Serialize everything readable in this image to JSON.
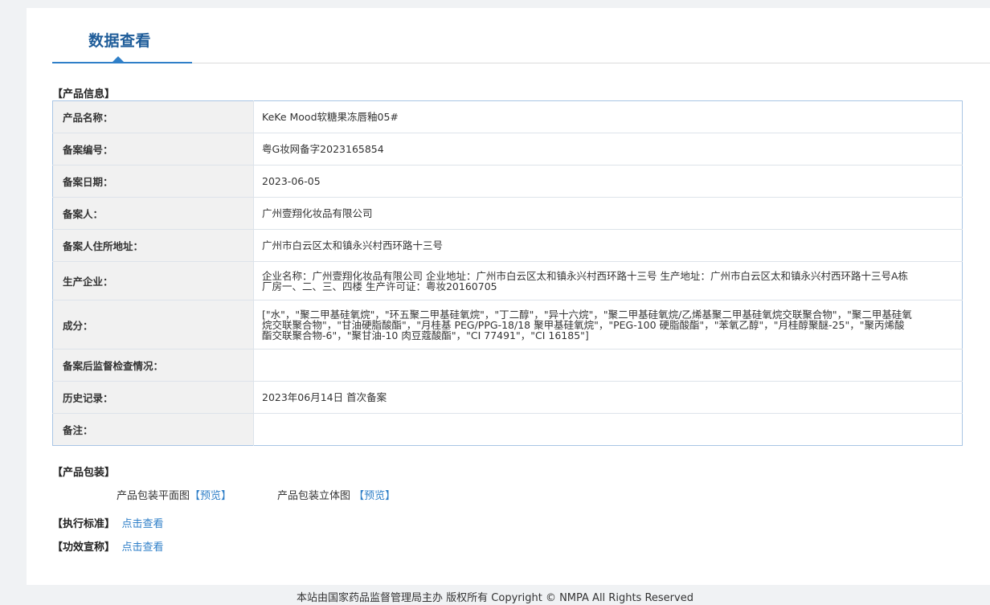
{
  "page": {
    "title": "数据查看"
  },
  "product_info": {
    "section_label": "【产品信息】",
    "rows": [
      {
        "label": "产品名称：",
        "value": "KeKe Mood软糖果冻唇釉05#"
      },
      {
        "label": "备案编号：",
        "value": "粤G妆网备字2023165854"
      },
      {
        "label": "备案日期：",
        "value": "2023-06-05"
      },
      {
        "label": "备案人：",
        "value": "广州壹翔化妆品有限公司"
      },
      {
        "label": "备案人住所地址：",
        "value": "广州市白云区太和镇永兴村西环路十三号"
      },
      {
        "label": "生产企业：",
        "value": "企业名称：广州壹翔化妆品有限公司 企业地址：广州市白云区太和镇永兴村西环路十三号 生产地址：广州市白云区太和镇永兴村西环路十三号A栋厂房一、二、三、四楼 生产许可证：粤妆20160705"
      },
      {
        "label": "成分：",
        "value": "[\"水\"，\"聚二甲基硅氧烷\"，\"环五聚二甲基硅氧烷\"，\"丁二醇\"，\"异十六烷\"，\"聚二甲基硅氧烷/乙烯基聚二甲基硅氧烷交联聚合物\"，\"聚二甲基硅氧烷交联聚合物\"，\"甘油硬脂酸酯\"，\"月桂基 PEG/PPG-18/18 聚甲基硅氧烷\"，\"PEG-100 硬脂酸酯\"，\"苯氧乙醇\"，\"月桂醇聚醚-25\"，\"聚丙烯酸酯交联聚合物-6\"，\"聚甘油-10 肉豆蔻酸酯\"，\"CI 77491\"，\"CI 16185\"]"
      },
      {
        "label": "备案后监督检查情况：",
        "value": ""
      },
      {
        "label": "历史记录：",
        "value": "2023年06月14日 首次备案"
      },
      {
        "label": "备注：",
        "value": ""
      }
    ]
  },
  "packaging": {
    "section_label": "【产品包装】",
    "flat_label": "产品包装平面图",
    "flat_link": "【预览】",
    "solid_label": "产品包装立体图",
    "solid_link": "【预览】"
  },
  "standard": {
    "section_label": "【执行标准】",
    "link": "点击查看"
  },
  "efficacy": {
    "section_label": "【功效宣称】",
    "link": "点击查看"
  },
  "footer": {
    "text": "本站由国家药品监督管理局主办 版权所有 Copyright © NMPA All Rights Reserved"
  }
}
